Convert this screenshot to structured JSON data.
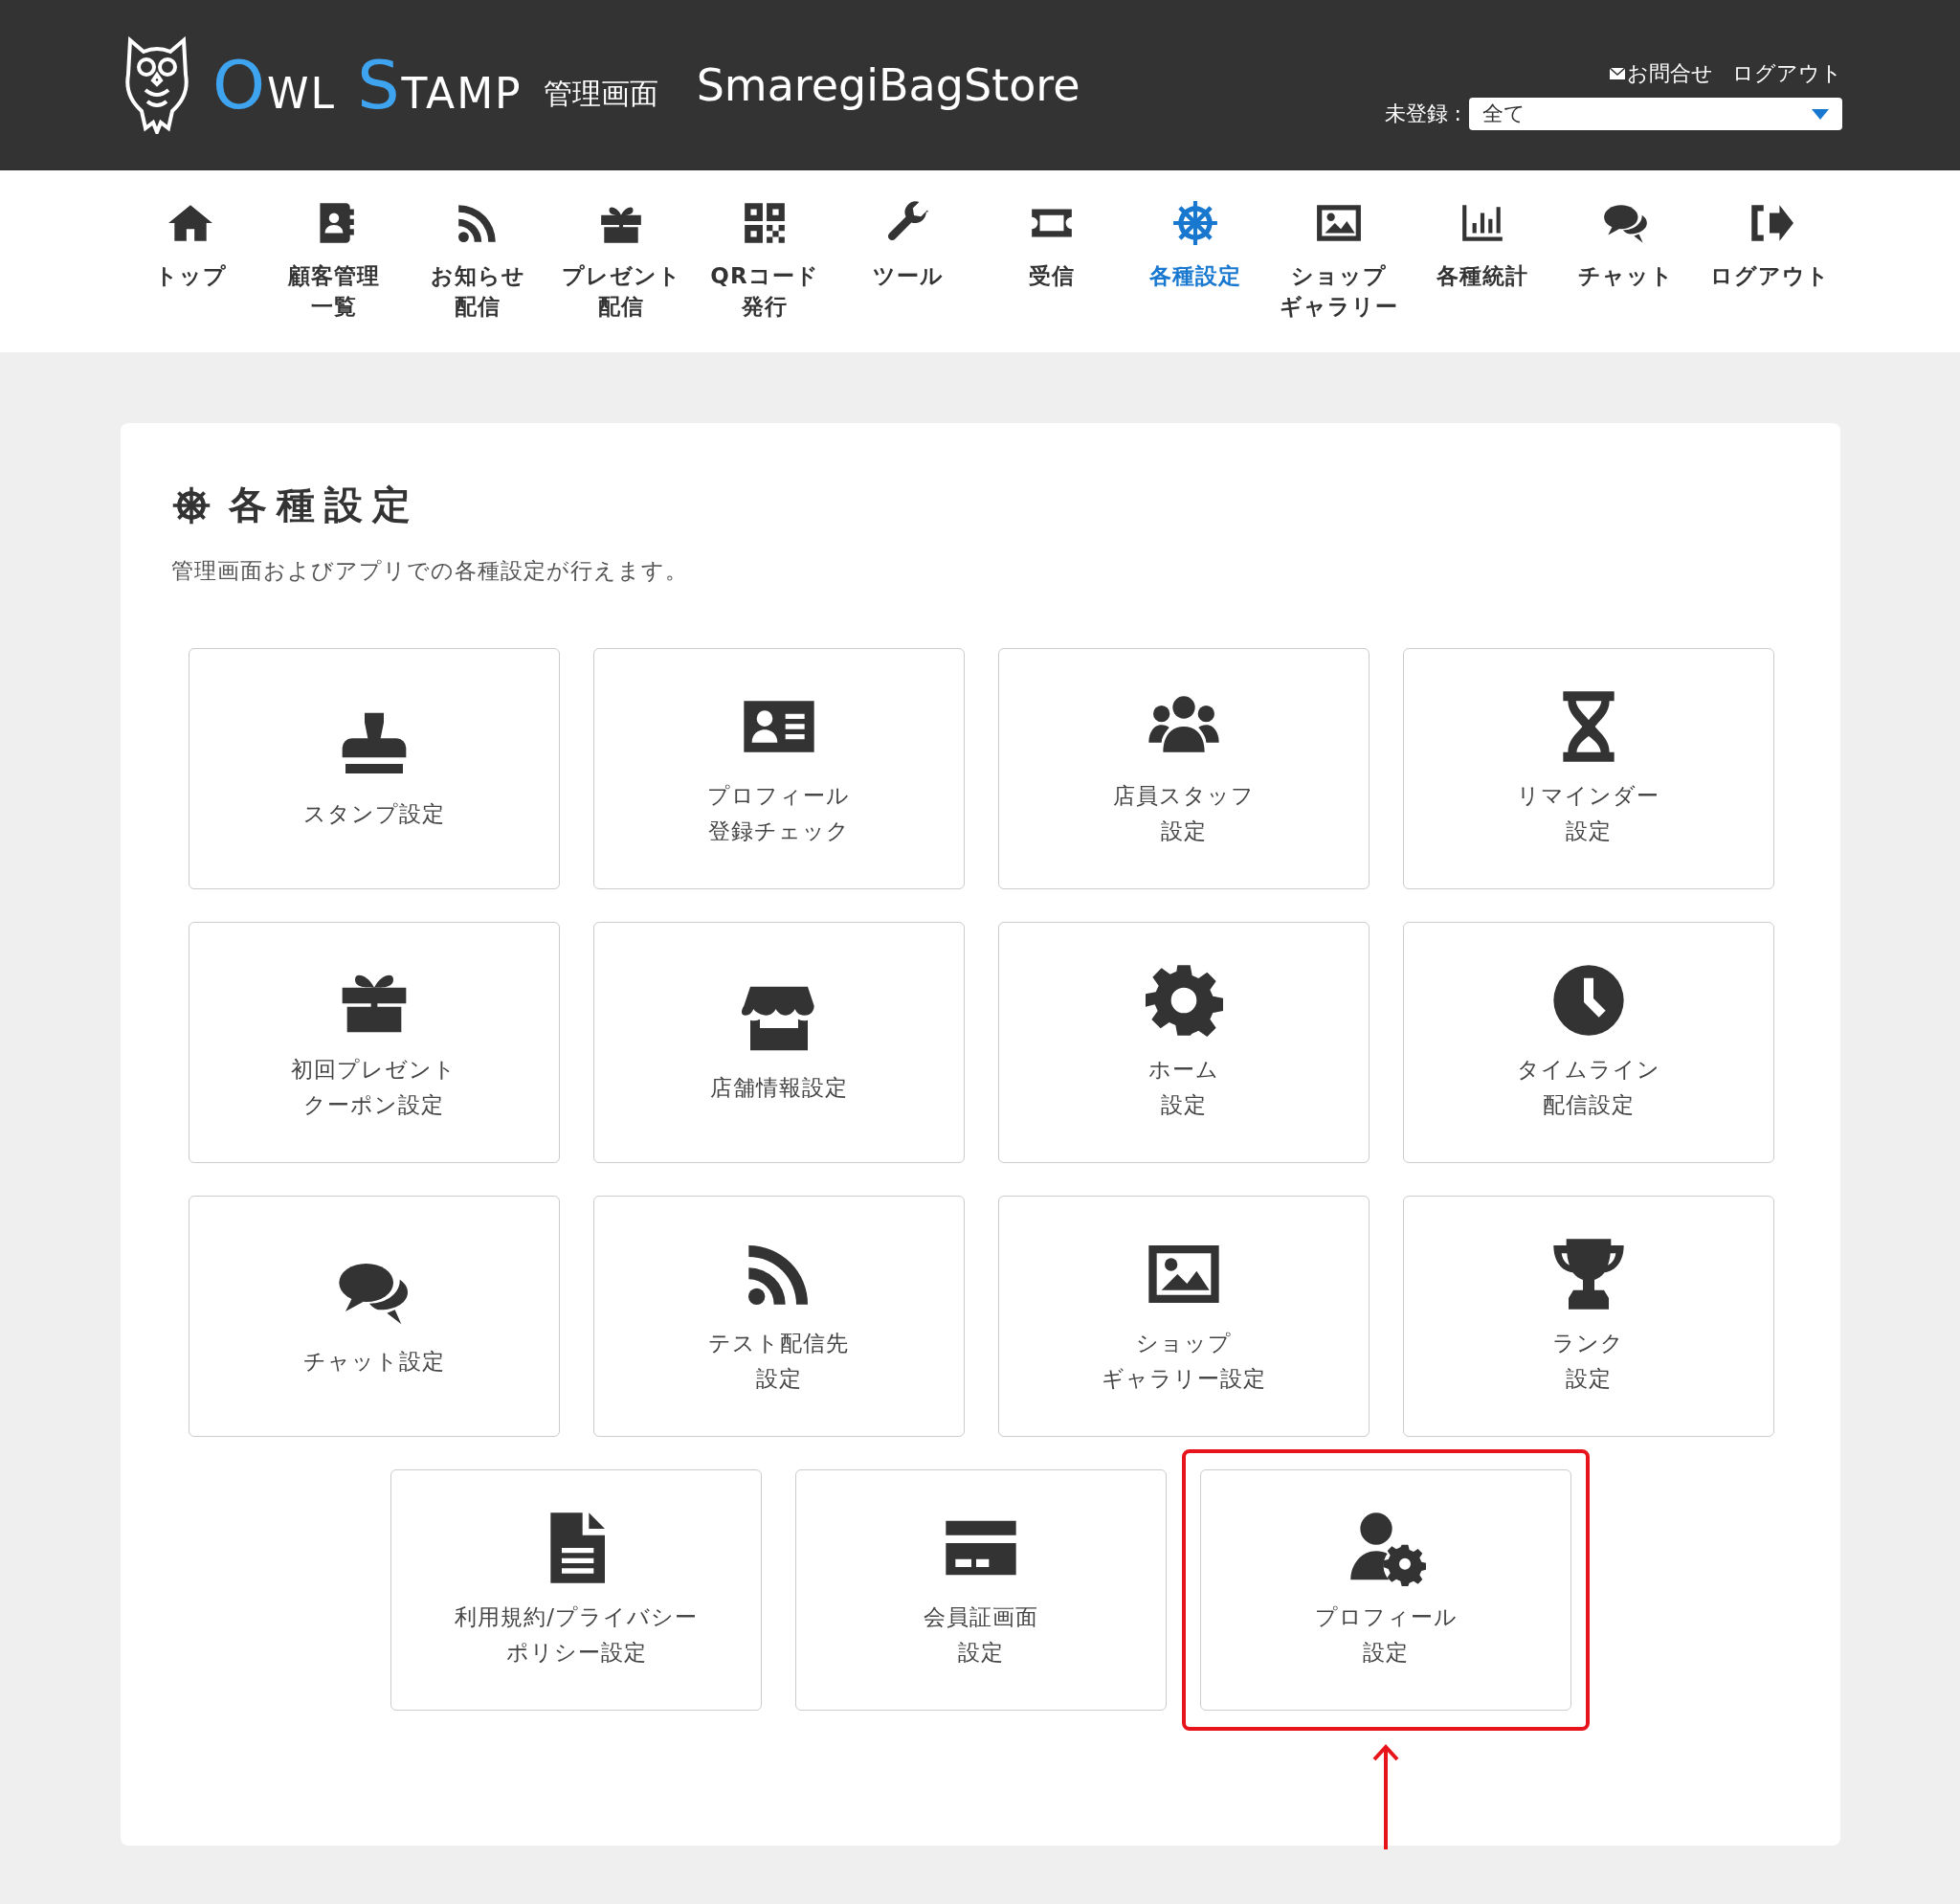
{
  "header": {
    "logo_words": [
      "OWL",
      "STAMP"
    ],
    "logo_subtitle": "管理画面",
    "store_name": "SmaregiBagStore",
    "links": [
      {
        "label": "お問合せ",
        "kind": "mail"
      },
      {
        "label": "ログアウト",
        "kind": "plain"
      }
    ],
    "filter": {
      "label": "未登録 :",
      "value": "全て"
    }
  },
  "nav": [
    {
      "lines": [
        "トップ"
      ],
      "selected": false
    },
    {
      "lines": [
        "顧客管理",
        "一覧"
      ],
      "selected": false
    },
    {
      "lines": [
        "お知らせ",
        "配信"
      ],
      "selected": false
    },
    {
      "lines": [
        "プレゼント",
        "配信"
      ],
      "selected": false
    },
    {
      "lines": [
        "QRコード",
        "発行"
      ],
      "selected": false
    },
    {
      "lines": [
        "ツール"
      ],
      "selected": false
    },
    {
      "lines": [
        "受信"
      ],
      "selected": false
    },
    {
      "lines": [
        "各種設定"
      ],
      "selected": true
    },
    {
      "lines": [
        "ショップ",
        "ギャラリー"
      ],
      "selected": false
    },
    {
      "lines": [
        "各種統計"
      ],
      "selected": false
    },
    {
      "lines": [
        "チャット"
      ],
      "selected": false
    },
    {
      "lines": [
        "ログアウト"
      ],
      "selected": false
    }
  ],
  "page": {
    "title": "各種設定",
    "description": "管理画面およびアプリでの各種設定が行えます。"
  },
  "tiles": [
    {
      "lines": [
        "スタンプ設定"
      ],
      "highlighted": false
    },
    {
      "lines": [
        "プロフィール",
        "登録チェック"
      ],
      "highlighted": false
    },
    {
      "lines": [
        "店員スタッフ",
        "設定"
      ],
      "highlighted": false
    },
    {
      "lines": [
        "リマインダー",
        "設定"
      ],
      "highlighted": false
    },
    {
      "lines": [
        "初回プレゼント",
        "クーポン設定"
      ],
      "highlighted": false
    },
    {
      "lines": [
        "店舗情報設定"
      ],
      "highlighted": false
    },
    {
      "lines": [
        "ホーム",
        "設定"
      ],
      "highlighted": false
    },
    {
      "lines": [
        "タイムライン",
        "配信設定"
      ],
      "highlighted": false
    },
    {
      "lines": [
        "チャット設定"
      ],
      "highlighted": false
    },
    {
      "lines": [
        "テスト配信先",
        "設定"
      ],
      "highlighted": false
    },
    {
      "lines": [
        "ショップ",
        "ギャラリー設定"
      ],
      "highlighted": false
    },
    {
      "lines": [
        "ランク",
        "設定"
      ],
      "highlighted": false
    },
    {
      "lines": [
        "利用規約/プライバシー",
        "ポリシー設定"
      ],
      "highlighted": false
    },
    {
      "lines": [
        "会員証画面",
        "設定"
      ],
      "highlighted": false
    },
    {
      "lines": [
        "プロフィール",
        "設定"
      ],
      "highlighted": true
    }
  ]
}
